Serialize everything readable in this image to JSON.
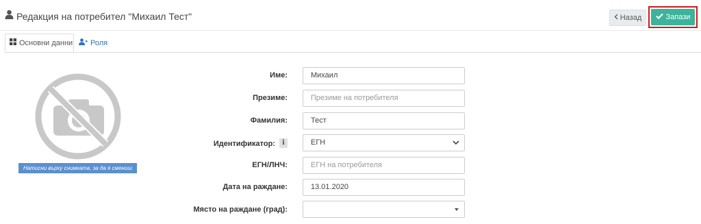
{
  "header": {
    "title": "Редакция на потребител \"Михаил Тест\"",
    "back_label": "Назад",
    "save_label": "Запази"
  },
  "tabs": [
    {
      "label": "Основни данни",
      "icon": "grid-icon",
      "active": true
    },
    {
      "label": "Роля",
      "icon": "user-plus-icon",
      "active": false
    }
  ],
  "photo": {
    "icon": "no-camera-icon",
    "caption": "Натисни върху снимката, за да я смениш"
  },
  "form": {
    "first_name": {
      "label": "Име:",
      "value": "Михаил"
    },
    "middle_name": {
      "label": "Презиме:",
      "placeholder": "Презиме на потребителя"
    },
    "last_name": {
      "label": "Фамилия:",
      "value": "Тест"
    },
    "identifier": {
      "label": "Идентификатор:",
      "info": "i",
      "value": "ЕГН"
    },
    "egn": {
      "label": "ЕГН/ЛНЧ:",
      "placeholder": "ЕГН на потребителя"
    },
    "birth_date": {
      "label": "Дата на раждане:",
      "value": "13.01.2020"
    },
    "birth_place": {
      "label": "Място на раждане (град):",
      "value": ""
    }
  },
  "colors": {
    "accent": "#3cb39a",
    "link": "#2e74c6",
    "highlight": "#cc1a1a",
    "caption_bg": "#5b8fd0"
  }
}
